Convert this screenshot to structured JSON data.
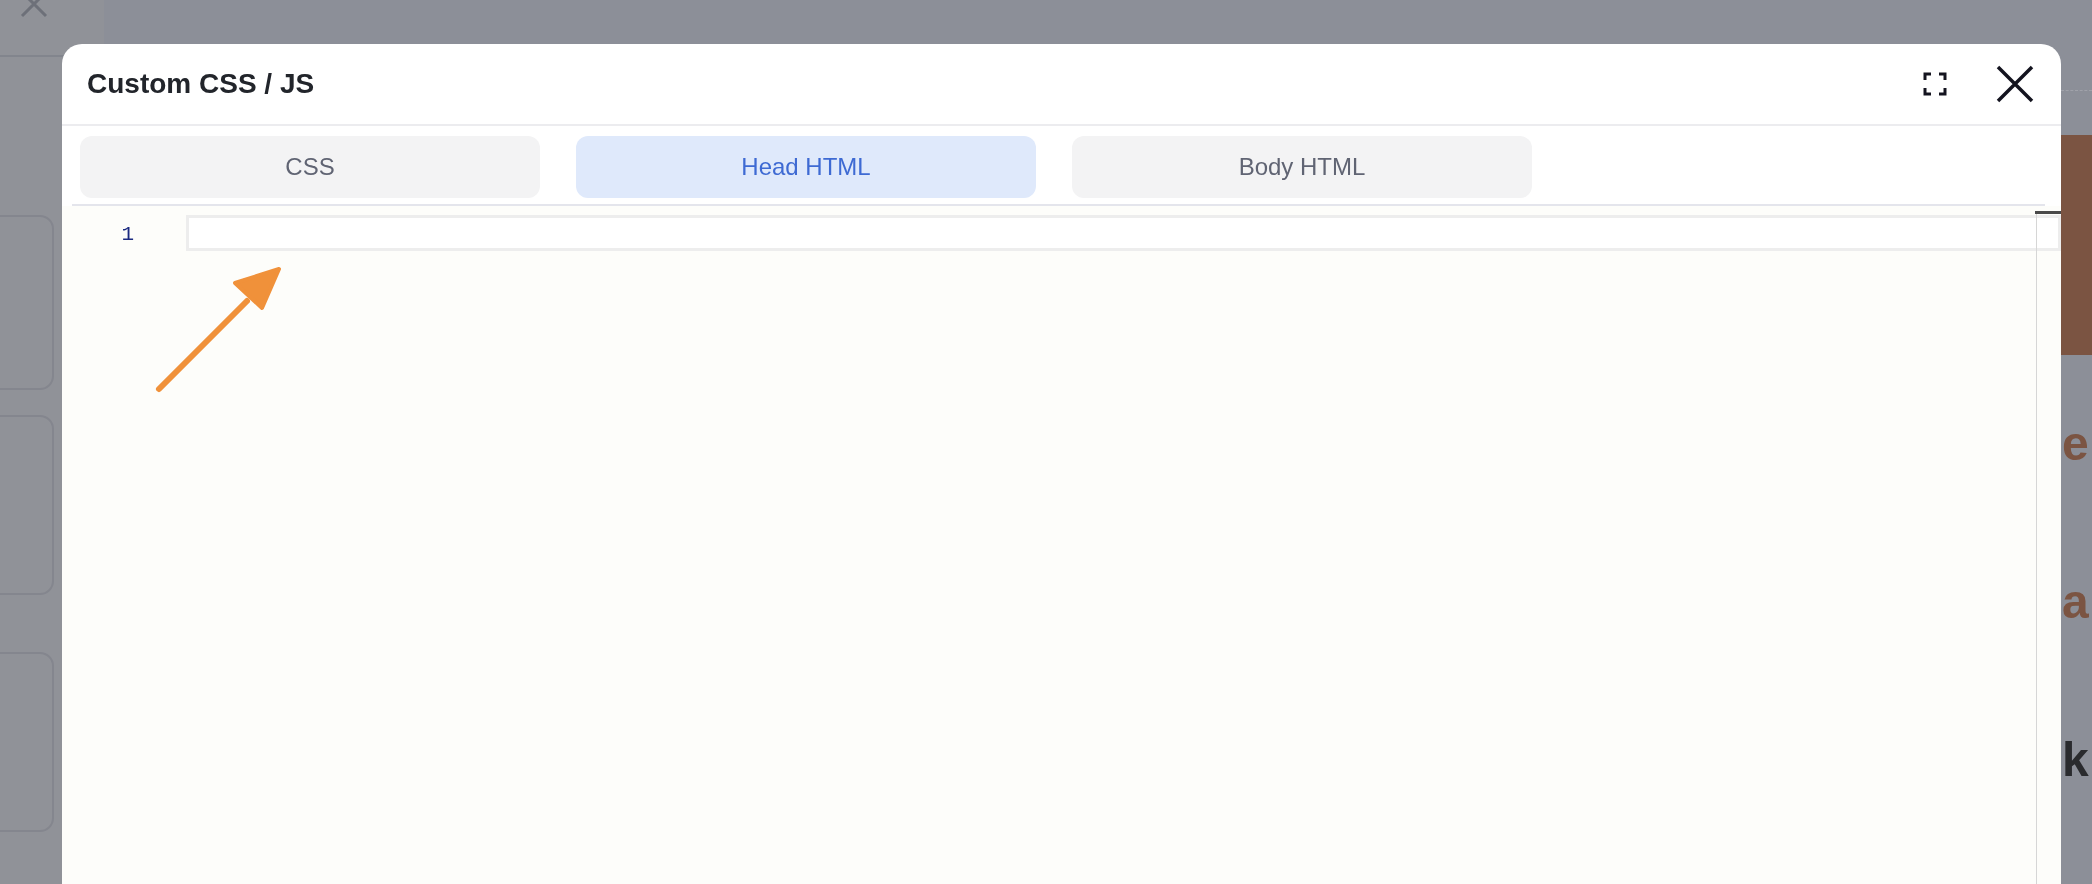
{
  "background": {
    "headings": [
      {
        "text": "e",
        "kind": "accent"
      },
      {
        "text": "a",
        "kind": "accent"
      },
      {
        "text": "k",
        "kind": "dark"
      }
    ]
  },
  "dialog": {
    "title": "Custom CSS / JS",
    "tabs": [
      {
        "label": "CSS",
        "selected": false
      },
      {
        "label": "Head HTML",
        "selected": true
      },
      {
        "label": "Body HTML",
        "selected": false
      }
    ],
    "editor": {
      "lines": [
        {
          "number": "1",
          "current": true
        }
      ]
    }
  }
}
